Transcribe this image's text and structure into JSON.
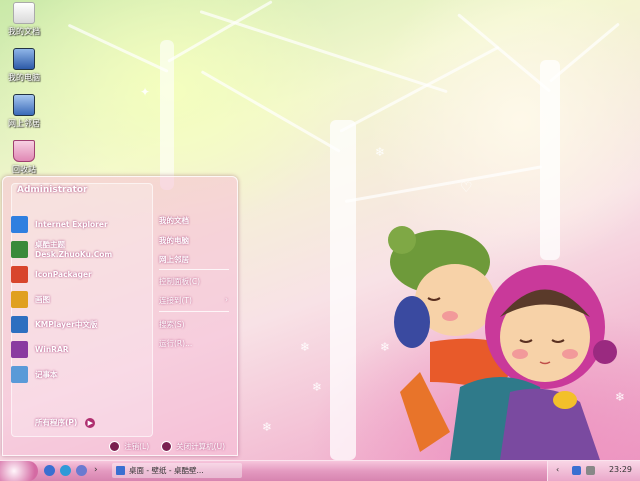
{
  "desktop_icons": [
    {
      "label": "我的文档",
      "icon": "folder-documents-icon"
    },
    {
      "label": "我的电脑",
      "icon": "computer-icon"
    },
    {
      "label": "网上邻居",
      "icon": "network-icon"
    },
    {
      "label": "回收站",
      "icon": "recycle-bin-icon"
    }
  ],
  "start_menu": {
    "user": "Administrator",
    "programs": [
      {
        "label": "Internet Explorer",
        "icon": "ie-icon",
        "color": "#2f7fe0"
      },
      {
        "label": "桌酷主题Desk.ZhuoKu.Com",
        "icon": "zhuoku-icon",
        "color": "#3a8a3a"
      },
      {
        "label": "IconPackager",
        "icon": "iconpackager-icon",
        "color": "#d8452c"
      },
      {
        "label": "画图",
        "icon": "paint-icon",
        "color": "#e0a020"
      },
      {
        "label": "KMPlayer中文版",
        "icon": "kmplayer-icon",
        "color": "#2e6fc0"
      },
      {
        "label": "WinRAR",
        "icon": "winrar-icon",
        "color": "#8a3aa0"
      },
      {
        "label": "记事本",
        "icon": "notepad-icon",
        "color": "#5a9ad8"
      }
    ],
    "all_programs": "所有程序(P)",
    "right_items": [
      {
        "label": "我的文档"
      },
      {
        "label": "我的电脑"
      },
      {
        "label": "网上邻居"
      },
      {
        "label": "控制面板(C)"
      },
      {
        "label": "连接到(T)"
      },
      {
        "label": "搜索(S)"
      },
      {
        "label": "运行(R)..."
      }
    ],
    "logoff": "注销(L)",
    "shutdown": "关闭计算机(U)"
  },
  "taskbar": {
    "task": "桌面 - 壁纸 - 桌酷壁...",
    "clock": "23:29"
  },
  "colors": {
    "accent": "#d46aa3",
    "taskbar": "#e49ac0"
  }
}
